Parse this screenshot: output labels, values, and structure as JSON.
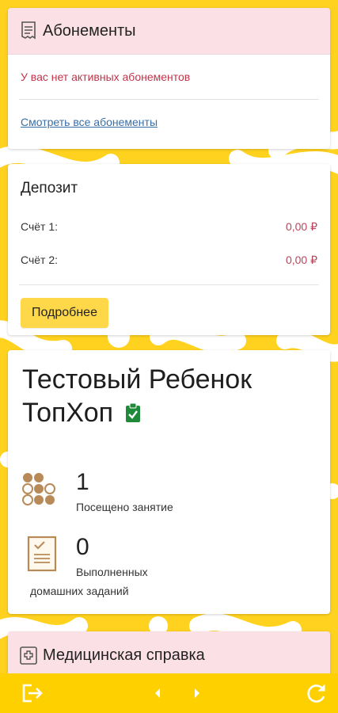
{
  "subscriptions": {
    "title": "Абонементы",
    "icon": "receipt-icon",
    "empty_message": "У вас нет активных абонементов",
    "view_all_link": "Смотреть все абонементы"
  },
  "deposit": {
    "title": "Депозит",
    "accounts": [
      {
        "label": "Счёт 1:",
        "value": "0,00 ₽"
      },
      {
        "label": "Счёт 2:",
        "value": "0,00 ₽"
      }
    ],
    "details_button": "Подробнее"
  },
  "child": {
    "name_line1": "Тестовый Ребенок",
    "name_line2": "ТопХоп",
    "verified_icon": "clipboard-check-icon",
    "stats": [
      {
        "icon": "dots-grid-icon",
        "value": "1",
        "label": "Посещено занятие"
      },
      {
        "icon": "homework-document-icon",
        "value": "0",
        "label_line1": "Выполненных",
        "label_line2": "домашних заданий"
      }
    ]
  },
  "medical": {
    "title": "Медицинская справка",
    "icon": "medical-cross-icon"
  },
  "bottom_bar": {
    "icons": [
      "logout-icon",
      "arrow-left-icon",
      "arrow-right-icon",
      "refresh-icon"
    ]
  },
  "colors": {
    "background": "#ffd21f",
    "header_pink": "#fbe1e6",
    "bottom_bar": "#ffd000",
    "accent_red": "#c0334a",
    "link_blue": "#3a6fa6",
    "verified_green": "#1f8a3a"
  }
}
